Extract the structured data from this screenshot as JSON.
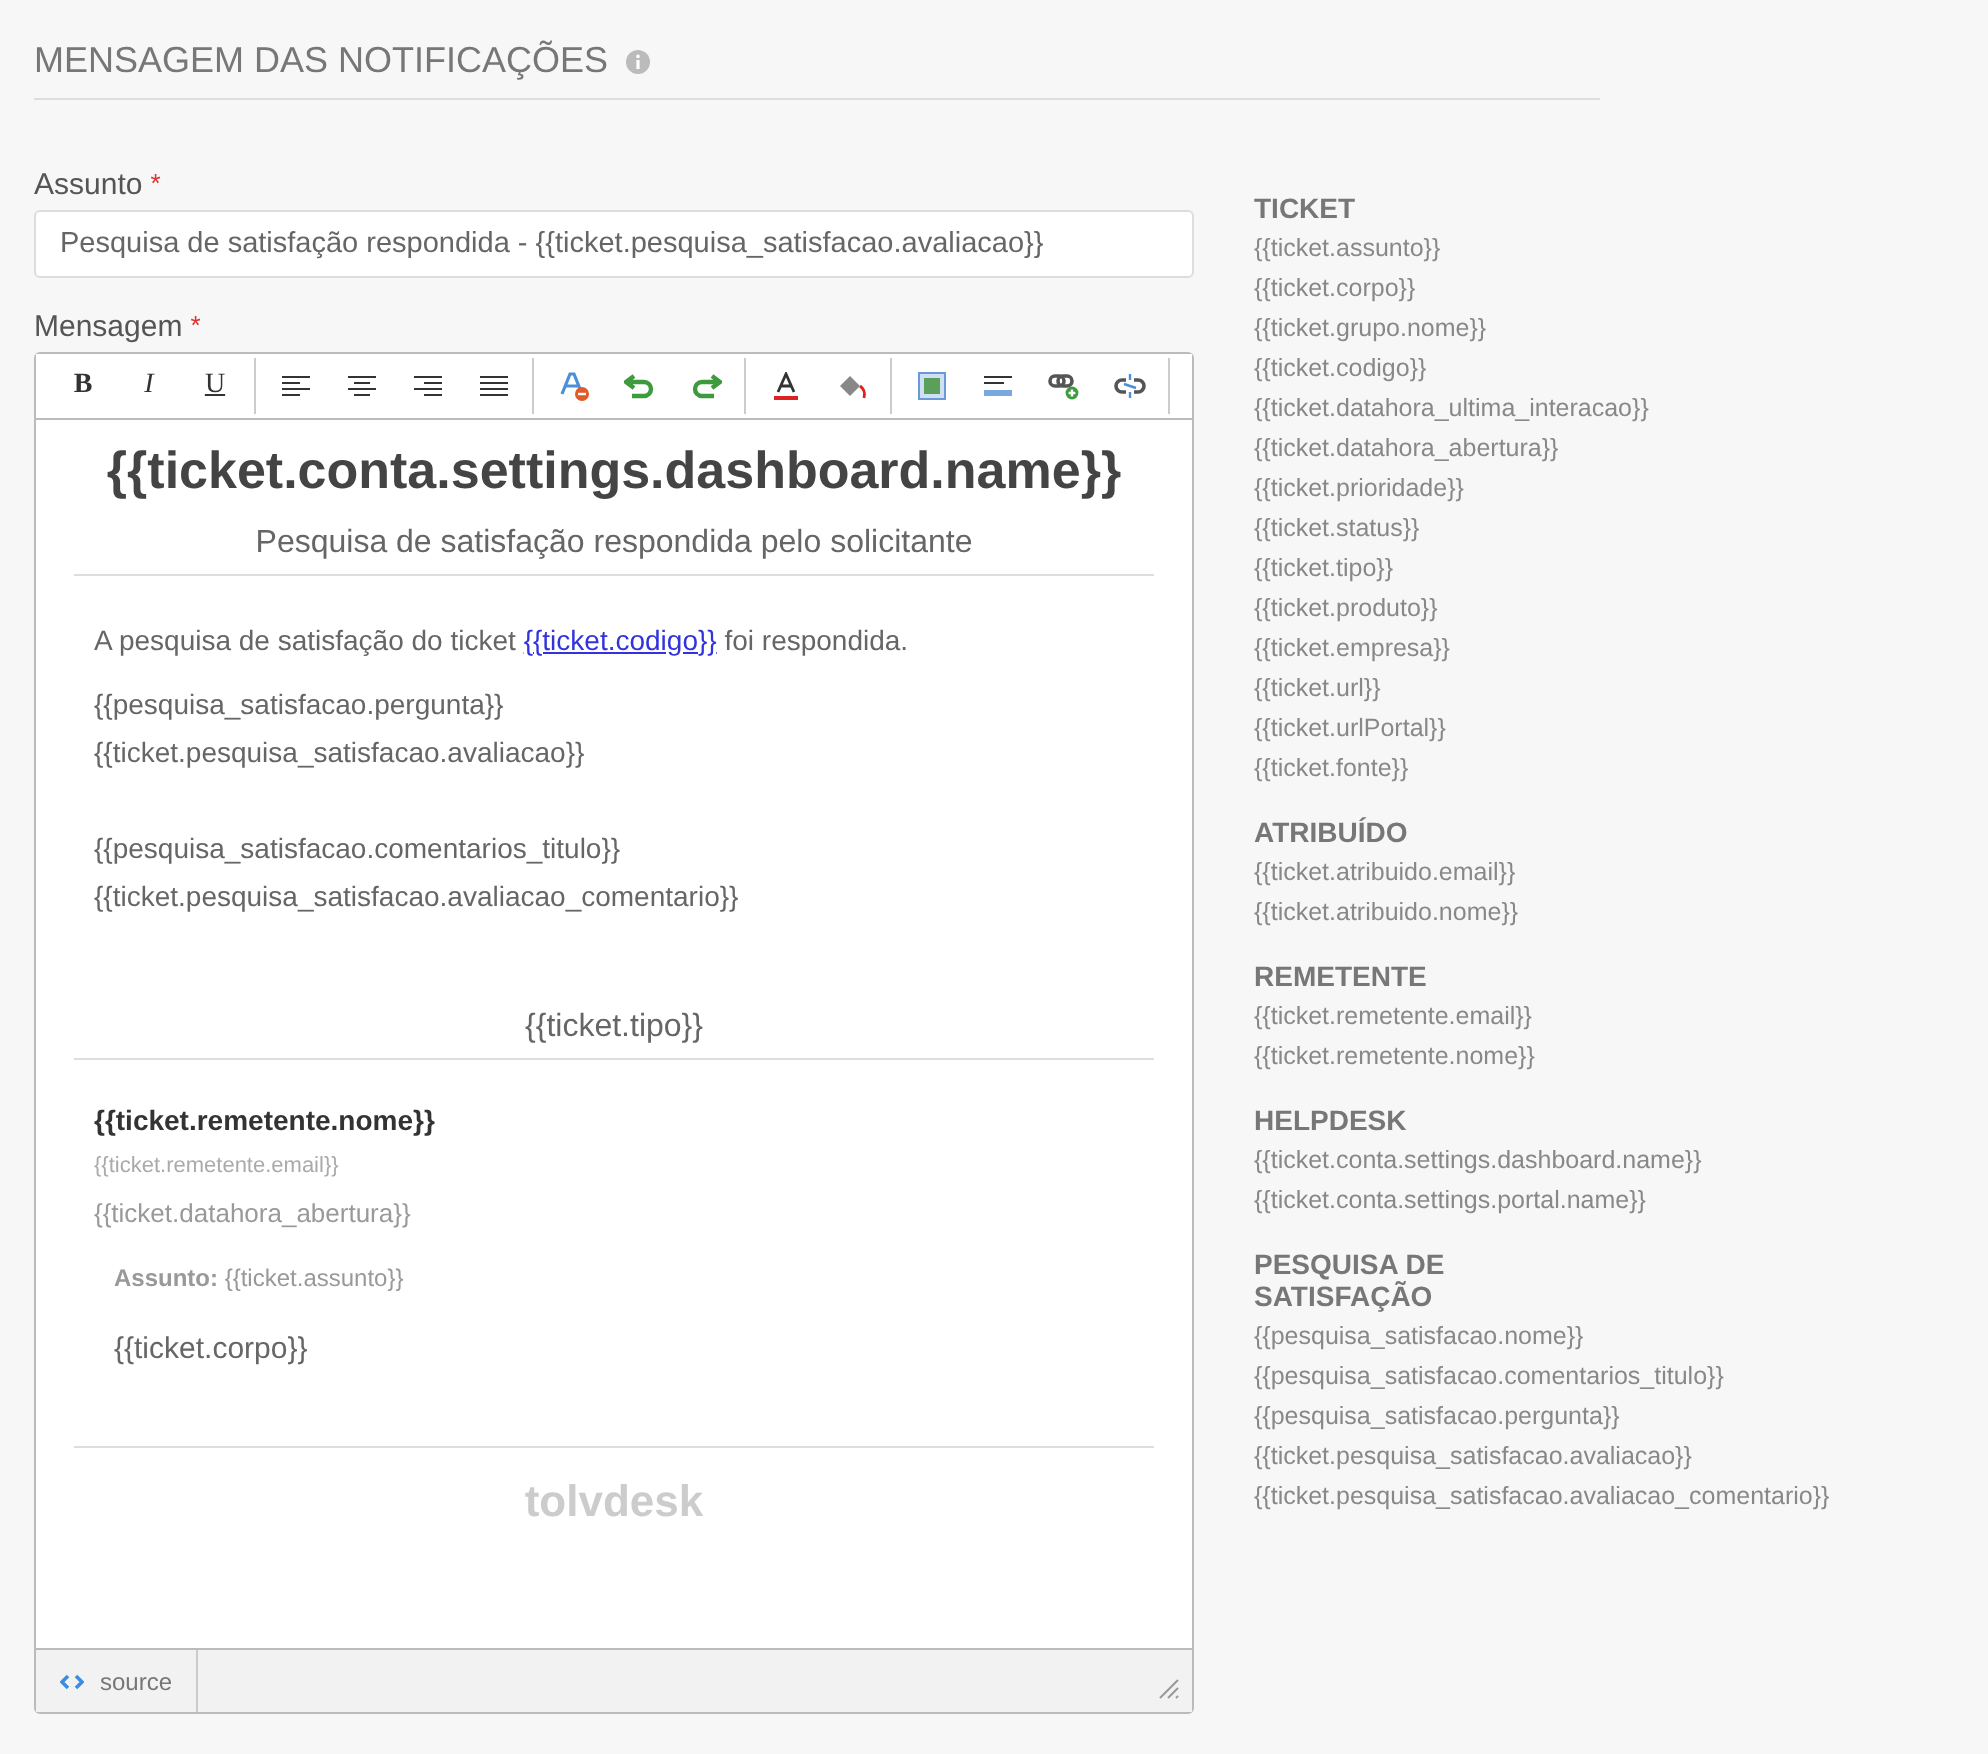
{
  "section": {
    "title": "MENSAGEM DAS NOTIFICAÇÕES"
  },
  "subject": {
    "label": "Assunto",
    "required_mark": "*",
    "value": "Pesquisa de satisfação respondida - {{ticket.pesquisa_satisfacao.avaliacao}}"
  },
  "message": {
    "label": "Mensagem",
    "required_mark": "*",
    "toolbar": [
      [
        {
          "kind": "bold",
          "label": "B"
        },
        {
          "kind": "italic",
          "label": "I"
        },
        {
          "kind": "underline",
          "label": "U"
        }
      ],
      [
        {
          "kind": "align-left"
        },
        {
          "kind": "align-center"
        },
        {
          "kind": "align-right"
        },
        {
          "kind": "justify"
        }
      ],
      [
        {
          "kind": "clear-format"
        },
        {
          "kind": "undo"
        },
        {
          "kind": "redo"
        }
      ],
      [
        {
          "kind": "text-color"
        },
        {
          "kind": "fill"
        }
      ],
      [
        {
          "kind": "image"
        },
        {
          "kind": "rule"
        },
        {
          "kind": "link"
        },
        {
          "kind": "unlink"
        }
      ]
    ],
    "content": {
      "heading": "{{ticket.conta.settings.dashboard.name}}",
      "subtitle": "Pesquisa de satisfação respondida pelo solicitante",
      "intro_before": "A pesquisa de satisfação do ticket ",
      "intro_link": "{{ticket.codigo}}",
      "intro_after": " foi respondida.",
      "block_1": [
        "{{pesquisa_satisfacao.pergunta}}",
        "{{ticket.pesquisa_satisfacao.avaliacao}}"
      ],
      "block_2": [
        "{{pesquisa_satisfacao.comentarios_titulo}}",
        "{{ticket.pesquisa_satisfacao.avaliacao_comentario}}"
      ],
      "type": "{{ticket.tipo}}",
      "sender_name": "{{ticket.remetente.nome}}",
      "sender_email": "{{ticket.remetente.email}}",
      "opened_at": "{{ticket.datahora_abertura}}",
      "subject_line": "**Assunto:** {{ticket.assunto}}",
      "body": "{{ticket.corpo}}",
      "brand": "tolvdesk"
    },
    "source_button": "source"
  },
  "variables": [
    {
      "title": "TICKET",
      "items": [
        "{{ticket.assunto}}",
        "{{ticket.corpo}}",
        "{{ticket.grupo.nome}}",
        "{{ticket.codigo}}",
        "{{ticket.datahora_ultima_interacao}}",
        "{{ticket.datahora_abertura}}",
        "{{ticket.prioridade}}",
        "{{ticket.status}}",
        "{{ticket.tipo}}",
        "{{ticket.produto}}",
        "{{ticket.empresa}}",
        "{{ticket.url}}",
        "{{ticket.urlPortal}}",
        "{{ticket.fonte}}"
      ]
    },
    {
      "title": "ATRIBUÍDO",
      "items": [
        "{{ticket.atribuido.email}}",
        "{{ticket.atribuido.nome}}"
      ]
    },
    {
      "title": "REMETENTE",
      "items": [
        "{{ticket.remetente.email}}",
        "{{ticket.remetente.nome}}"
      ]
    },
    {
      "title": "HELPDESK",
      "items": [
        "{{ticket.conta.settings.dashboard.name}}",
        "{{ticket.conta.settings.portal.name}}"
      ]
    },
    {
      "title": "PESQUISA DE SATISFAÇÃO",
      "items": [
        "{{pesquisa_satisfacao.nome}}",
        "{{pesquisa_satisfacao.comentarios_titulo}}",
        "{{pesquisa_satisfacao.pergunta}}",
        "{{ticket.pesquisa_satisfacao.avaliacao}}",
        "{{ticket.pesquisa_satisfacao.avaliacao_comentario}}"
      ]
    }
  ]
}
